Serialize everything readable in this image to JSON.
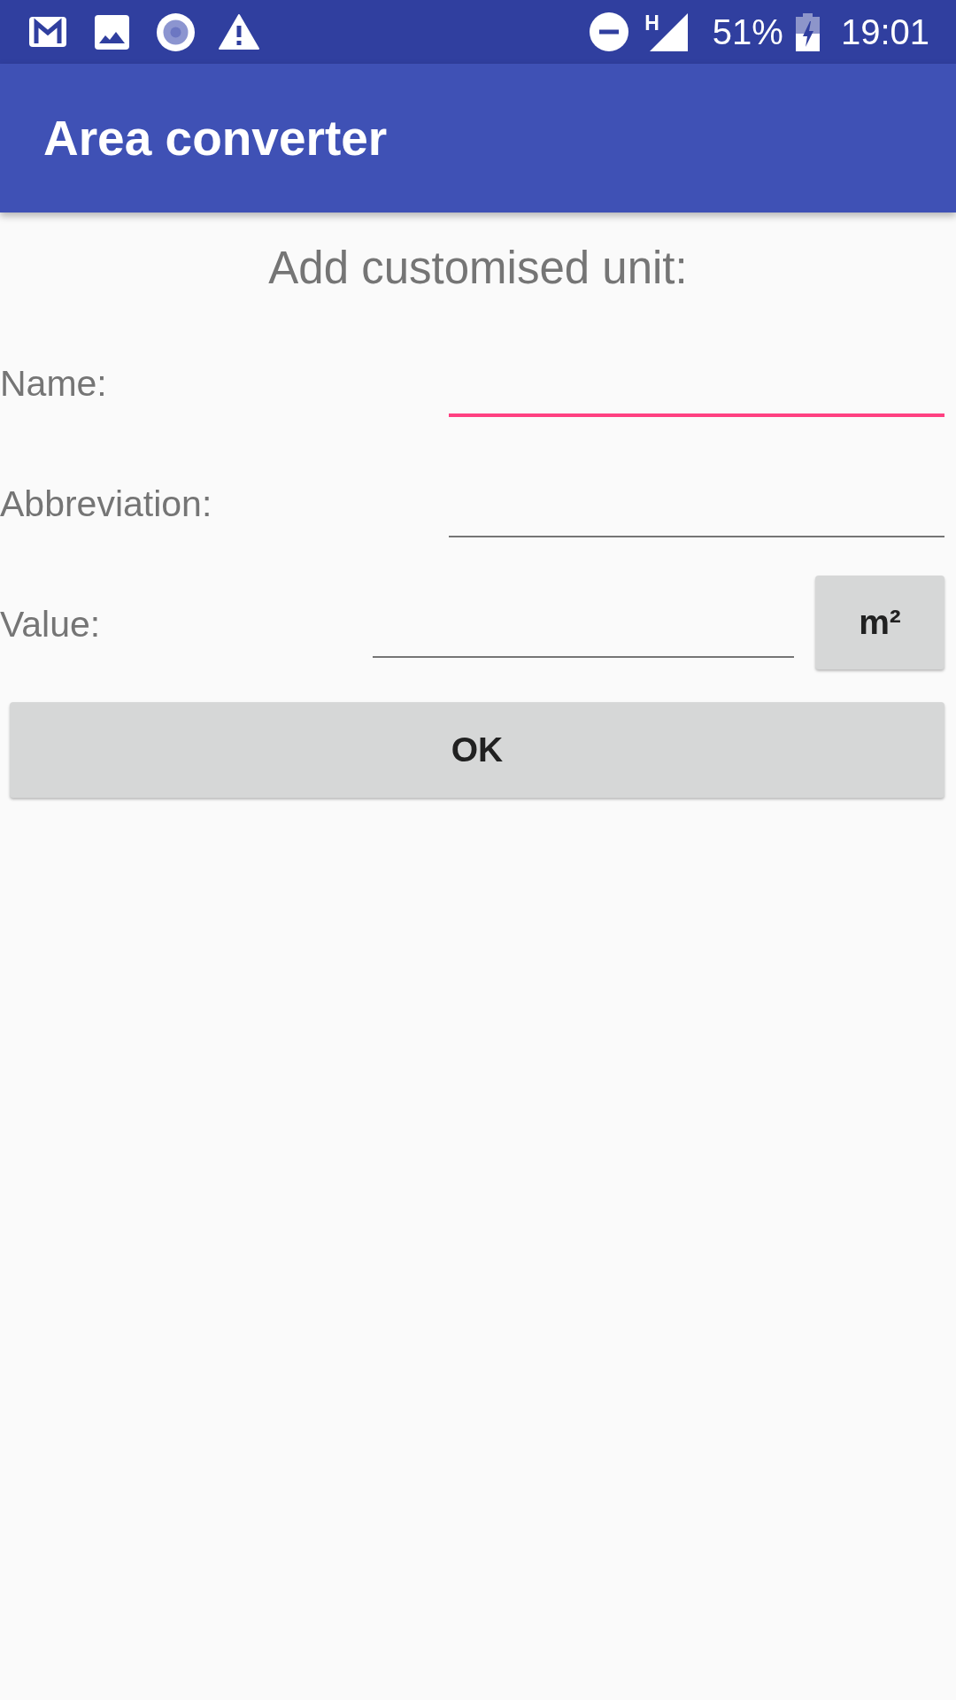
{
  "status_bar": {
    "network_type": "H",
    "battery": "51%",
    "charging": true,
    "time": "19:01"
  },
  "app_bar": {
    "title": "Area converter"
  },
  "form": {
    "heading": "Add customised unit:",
    "fields": [
      {
        "kind": "text",
        "label": "Name:",
        "focused": true
      },
      {
        "kind": "text",
        "label": "Abbreviation:",
        "focused": false
      },
      {
        "kind": "unit",
        "label": "Value:",
        "focused": false,
        "unit_button": "m²"
      }
    ],
    "ok_button": "OK"
  }
}
